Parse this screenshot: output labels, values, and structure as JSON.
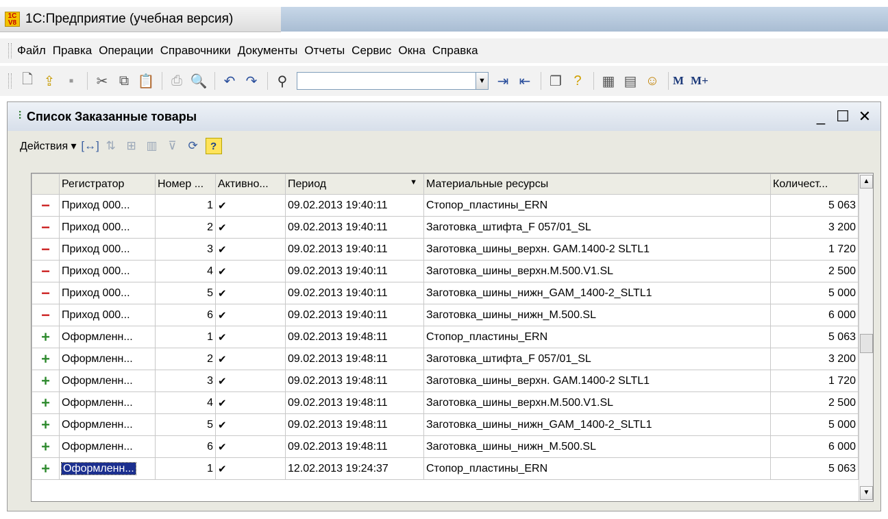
{
  "app": {
    "title": "1С:Предприятие (учебная версия)",
    "logo_top": "1С",
    "logo_bottom": "V8"
  },
  "menu": [
    "Файл",
    "Правка",
    "Операции",
    "Справочники",
    "Документы",
    "Отчеты",
    "Сервис",
    "Окна",
    "Справка"
  ],
  "toolbar": {
    "search_value": "",
    "m_label": "M",
    "mplus_label": "M+"
  },
  "window": {
    "title": "Список Заказанные товары",
    "actions_label": "Действия ▾",
    "help_label": "?"
  },
  "table": {
    "columns": [
      "",
      "Регистратор",
      "Номер ...",
      "Активно...",
      "Период",
      "Материальные ресурсы",
      "Количест..."
    ],
    "rows": [
      {
        "sign": "−",
        "type": "minus",
        "registrar": "Приход 000...",
        "num": "1",
        "active": "✔",
        "period": "09.02.2013 19:40:11",
        "resource": "Стопор_пластины_ERN",
        "qty": "5 063"
      },
      {
        "sign": "−",
        "type": "minus",
        "registrar": "Приход 000...",
        "num": "2",
        "active": "✔",
        "period": "09.02.2013 19:40:11",
        "resource": "Заготовка_штифта_F 057/01_SL",
        "qty": "3 200"
      },
      {
        "sign": "−",
        "type": "minus",
        "registrar": "Приход 000...",
        "num": "3",
        "active": "✔",
        "period": "09.02.2013 19:40:11",
        "resource": "Заготовка_шины_верхн. GAM.1400-2 SLTL1",
        "qty": "1 720"
      },
      {
        "sign": "−",
        "type": "minus",
        "registrar": "Приход 000...",
        "num": "4",
        "active": "✔",
        "period": "09.02.2013 19:40:11",
        "resource": "Заготовка_шины_верхн.M.500.V1.SL",
        "qty": "2 500"
      },
      {
        "sign": "−",
        "type": "minus",
        "registrar": "Приход 000...",
        "num": "5",
        "active": "✔",
        "period": "09.02.2013 19:40:11",
        "resource": "Заготовка_шины_нижн_GAM_1400-2_SLTL1",
        "qty": "5 000"
      },
      {
        "sign": "−",
        "type": "minus",
        "registrar": "Приход 000...",
        "num": "6",
        "active": "✔",
        "period": "09.02.2013 19:40:11",
        "resource": "Заготовка_шины_нижн_M.500.SL",
        "qty": "6 000"
      },
      {
        "sign": "+",
        "type": "plus",
        "registrar": "Оформленн...",
        "num": "1",
        "active": "✔",
        "period": "09.02.2013 19:48:11",
        "resource": "Стопор_пластины_ERN",
        "qty": "5 063"
      },
      {
        "sign": "+",
        "type": "plus",
        "registrar": "Оформленн...",
        "num": "2",
        "active": "✔",
        "period": "09.02.2013 19:48:11",
        "resource": "Заготовка_штифта_F 057/01_SL",
        "qty": "3 200"
      },
      {
        "sign": "+",
        "type": "plus",
        "registrar": "Оформленн...",
        "num": "3",
        "active": "✔",
        "period": "09.02.2013 19:48:11",
        "resource": "Заготовка_шины_верхн. GAM.1400-2 SLTL1",
        "qty": "1 720"
      },
      {
        "sign": "+",
        "type": "plus",
        "registrar": "Оформленн...",
        "num": "4",
        "active": "✔",
        "period": "09.02.2013 19:48:11",
        "resource": "Заготовка_шины_верхн.M.500.V1.SL",
        "qty": "2 500"
      },
      {
        "sign": "+",
        "type": "plus",
        "registrar": "Оформленн...",
        "num": "5",
        "active": "✔",
        "period": "09.02.2013 19:48:11",
        "resource": "Заготовка_шины_нижн_GAM_1400-2_SLTL1",
        "qty": "5 000"
      },
      {
        "sign": "+",
        "type": "plus",
        "registrar": "Оформленн...",
        "num": "6",
        "active": "✔",
        "period": "09.02.2013 19:48:11",
        "resource": "Заготовка_шины_нижн_M.500.SL",
        "qty": "6 000"
      },
      {
        "sign": "+",
        "type": "plus",
        "registrar": "Оформленн...",
        "num": "1",
        "active": "✔",
        "period": "12.02.2013 19:24:37",
        "resource": "Стопор_пластины_ERN",
        "qty": "5 063",
        "selected": true
      }
    ]
  },
  "colors": {
    "minus": "#cc2222",
    "plus": "#2e8a2e",
    "selection": "#1b2f8f"
  }
}
